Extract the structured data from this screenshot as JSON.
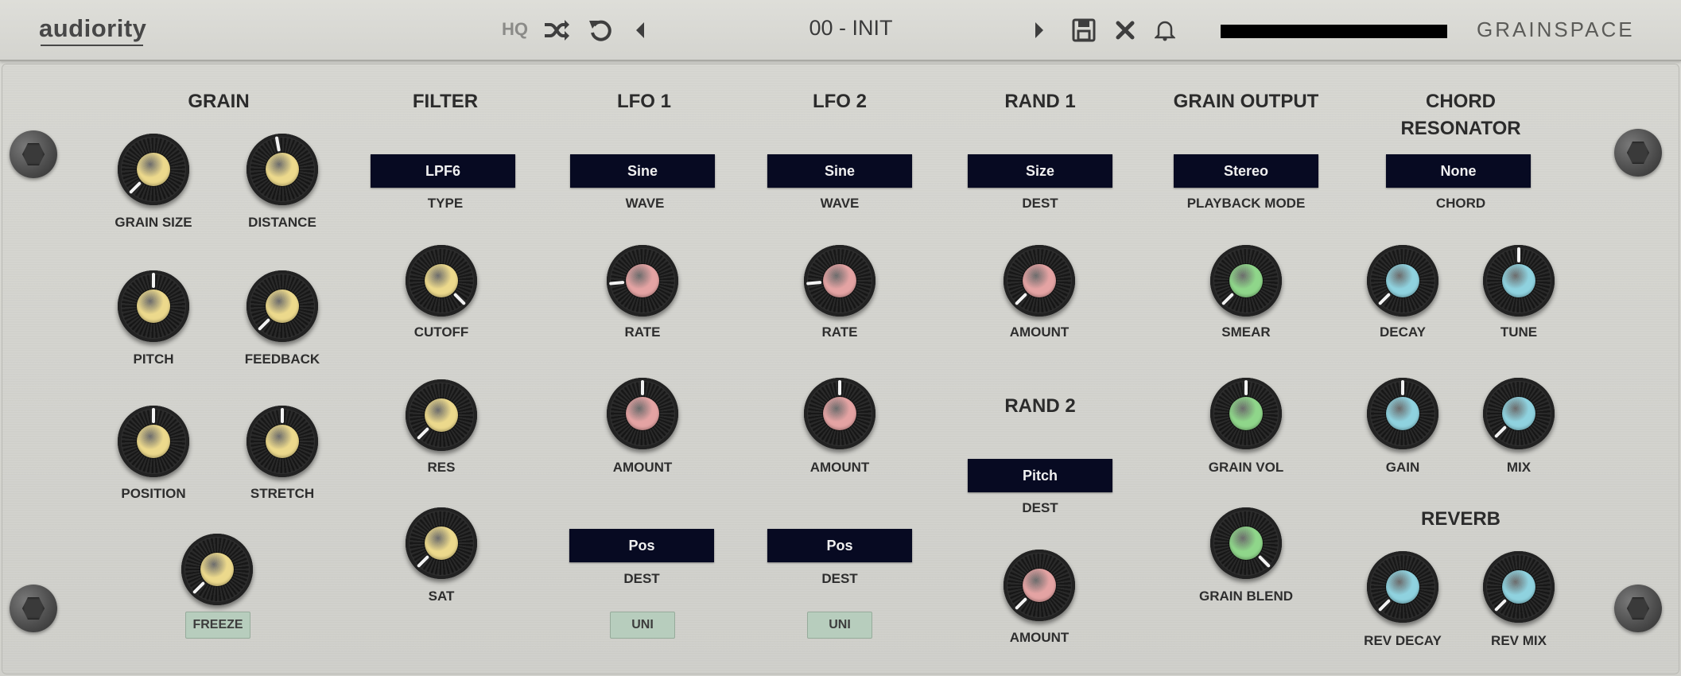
{
  "topbar": {
    "logo": "audiority",
    "hq_label": "HQ",
    "preset_name": "00 - INIT",
    "brand": "GRAINSPACE",
    "icons": [
      "shuffle-icon",
      "undo-icon",
      "prev-preset-icon",
      "next-preset-icon",
      "save-icon",
      "close-icon",
      "bell-icon"
    ]
  },
  "sections": {
    "grain": "GRAIN",
    "filter": "FILTER",
    "lfo1": "LFO 1",
    "lfo2": "LFO 2",
    "rand1": "RAND 1",
    "rand2": "RAND 2",
    "grain_output": "GRAIN OUTPUT",
    "chord_res_line1": "CHORD",
    "chord_res_line2": "RESONATOR",
    "reverb": "REVERB"
  },
  "dropdowns": {
    "filter_type": "LPF6",
    "lfo1_wave": "Sine",
    "lfo2_wave": "Sine",
    "rand1_dest": "Size",
    "grain_output_mode": "Stereo",
    "chord": "None",
    "rand2_dest": "Pitch",
    "lfo1_dest": "Pos",
    "lfo2_dest": "Pos"
  },
  "dropdown_labels": {
    "type": "TYPE",
    "wave": "WAVE",
    "dest": "DEST",
    "playback_mode": "PLAYBACK MODE",
    "chord": "CHORD"
  },
  "knobs": {
    "grain_size": {
      "label": "GRAIN SIZE",
      "angle": -135
    },
    "distance": {
      "label": "DISTANCE",
      "angle": -10
    },
    "pitch": {
      "label": "PITCH",
      "angle": 0
    },
    "feedback": {
      "label": "FEEDBACK",
      "angle": -135
    },
    "position": {
      "label": "POSITION",
      "angle": 0
    },
    "stretch": {
      "label": "STRETCH",
      "angle": 0
    },
    "freeze_knob": {
      "label": "",
      "angle": -135
    },
    "cutoff": {
      "label": "CUTOFF",
      "angle": 135
    },
    "res": {
      "label": "RES",
      "angle": -135
    },
    "sat": {
      "label": "SAT",
      "angle": -135
    },
    "lfo1_rate": {
      "label": "RATE",
      "angle": -95
    },
    "lfo1_amount": {
      "label": "AMOUNT",
      "angle": 0
    },
    "lfo2_rate": {
      "label": "RATE",
      "angle": -95
    },
    "lfo2_amount": {
      "label": "AMOUNT",
      "angle": 0
    },
    "rand1_amount": {
      "label": "AMOUNT",
      "angle": -135
    },
    "rand2_amount": {
      "label": "AMOUNT",
      "angle": -135
    },
    "smear": {
      "label": "SMEAR",
      "angle": -135
    },
    "grain_vol": {
      "label": "GRAIN VOL",
      "angle": 0
    },
    "grain_blend": {
      "label": "GRAIN BLEND",
      "angle": 135
    },
    "decay": {
      "label": "DECAY",
      "angle": -135
    },
    "tune": {
      "label": "TUNE",
      "angle": 0
    },
    "gain": {
      "label": "GAIN",
      "angle": 0
    },
    "mix": {
      "label": "MIX",
      "angle": -135
    },
    "rev_decay": {
      "label": "REV DECAY",
      "angle": -135
    },
    "rev_mix": {
      "label": "REV MIX",
      "angle": -135
    }
  },
  "buttons": {
    "freeze": "FREEZE",
    "lfo1_uni": "UNI",
    "lfo2_uni": "UNI"
  },
  "colors": {
    "grain_cap": "#ecd98c",
    "lfo_cap": "#e4a3a3",
    "output_cap": "#8fd68a",
    "reso_cap": "#8fd2df",
    "dropdown_bg": "#070a22",
    "button_bg": "#b7cdbd"
  }
}
